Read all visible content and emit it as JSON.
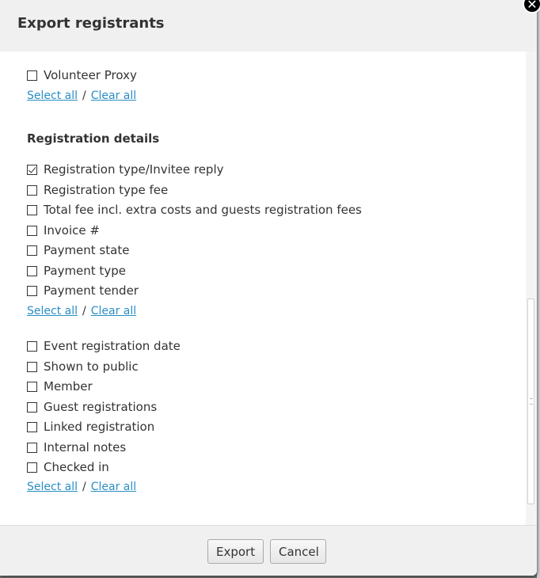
{
  "dialog": {
    "title": "Export registrants",
    "close_symbol": "✕"
  },
  "groups": [
    {
      "items": [
        {
          "label": "Volunteer Proxy",
          "checked": false
        }
      ],
      "select_all": "Select all",
      "separator": "/",
      "clear_all": "Clear all"
    },
    {
      "heading": "Registration details",
      "items": [
        {
          "label": "Registration type/Invitee reply",
          "checked": true
        },
        {
          "label": "Registration type fee",
          "checked": false
        },
        {
          "label": "Total fee incl. extra costs and guests registration fees",
          "checked": false
        },
        {
          "label": "Invoice #",
          "checked": false
        },
        {
          "label": "Payment state",
          "checked": false
        },
        {
          "label": "Payment type",
          "checked": false
        },
        {
          "label": "Payment tender",
          "checked": false
        }
      ],
      "select_all": "Select all",
      "separator": "/",
      "clear_all": "Clear all"
    },
    {
      "items": [
        {
          "label": "Event registration date",
          "checked": false
        },
        {
          "label": "Shown to public",
          "checked": false
        },
        {
          "label": "Member",
          "checked": false
        },
        {
          "label": "Guest registrations",
          "checked": false
        },
        {
          "label": "Linked registration",
          "checked": false
        },
        {
          "label": "Internal notes",
          "checked": false
        },
        {
          "label": "Checked in",
          "checked": false
        }
      ],
      "select_all": "Select all",
      "separator": "/",
      "clear_all": "Clear all"
    }
  ],
  "footer": {
    "export_label": "Export",
    "cancel_label": "Cancel"
  },
  "colors": {
    "link": "#2a8ec4",
    "header_bg": "#f0f0f0",
    "text": "#333333"
  }
}
